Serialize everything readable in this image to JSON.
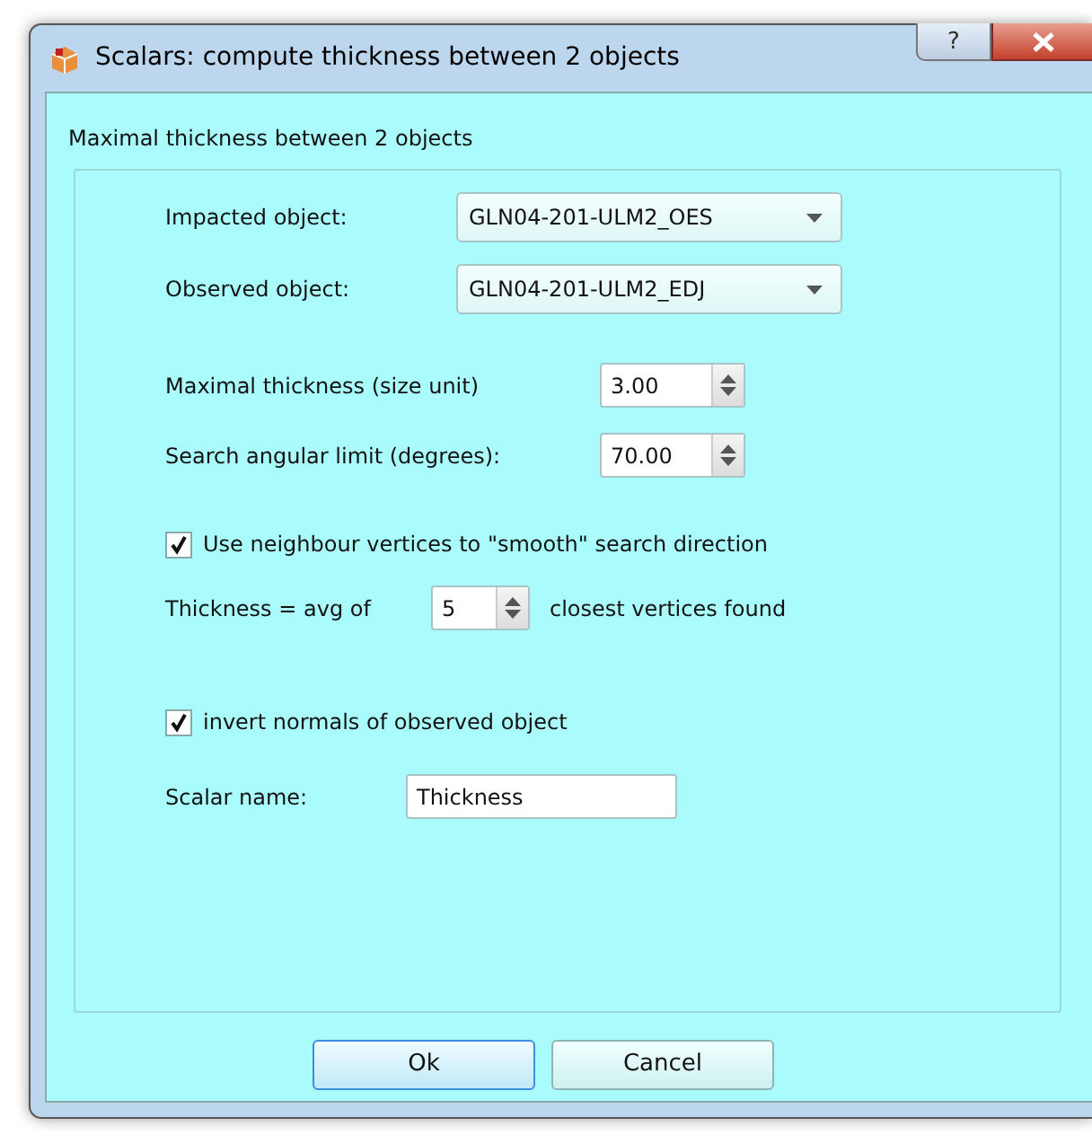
{
  "window": {
    "title": "Scalars: compute thickness between 2 objects",
    "help_button": "?"
  },
  "group": {
    "title": "Maximal thickness between 2 objects"
  },
  "combos": [
    {
      "label": "Impacted object:",
      "value": "GLN04-201-ULM2_OES"
    },
    {
      "label": "Observed object:",
      "value": "GLN04-201-ULM2_EDJ"
    }
  ],
  "spins": [
    {
      "label": "Maximal thickness (size unit)",
      "value": "3.00"
    },
    {
      "label": "Search angular limit (degrees):",
      "value": "70.00"
    }
  ],
  "smooth_checkbox": {
    "label": "Use neighbour vertices to \"smooth\" search direction",
    "checked": true
  },
  "avg_row": {
    "label": "Thickness = avg of",
    "value": "5",
    "suffix": "closest vertices found"
  },
  "invert_checkbox": {
    "label": "invert normals of observed object",
    "checked": true
  },
  "scalar_name": {
    "label": "Scalar name:",
    "value": "Thickness"
  },
  "buttons": [
    {
      "label": "Ok",
      "default": true
    },
    {
      "label": "Cancel",
      "default": false
    }
  ]
}
